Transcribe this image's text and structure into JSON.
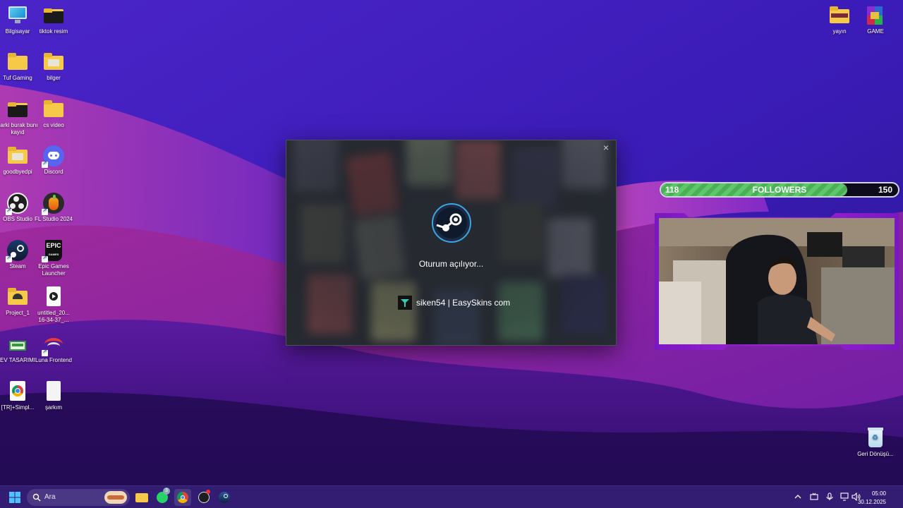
{
  "desktop": {
    "left_icons": [
      {
        "label": "Bilgisayar",
        "icon": "monitor-icon"
      },
      {
        "label": "tiktok resim",
        "icon": "folder-icon"
      },
      {
        "label": "Tuf Gaming",
        "icon": "folder-icon"
      },
      {
        "label": "bilger",
        "icon": "folder-icon"
      },
      {
        "label": "sarki burak bunı kayıd",
        "icon": "folder-icon"
      },
      {
        "label": "cs video",
        "icon": "folder-icon"
      },
      {
        "label": "goodbyedpi",
        "icon": "folder-icon"
      },
      {
        "label": "Discord",
        "icon": "discord-icon"
      },
      {
        "label": "OBS Studio",
        "icon": "obs-icon"
      },
      {
        "label": "FL Studio 2024",
        "icon": "fl-studio-icon"
      },
      {
        "label": "Steam",
        "icon": "steam-icon"
      },
      {
        "label": "Epic Games Launcher",
        "icon": "epic-games-icon"
      },
      {
        "label": "Project_1",
        "icon": "folder-icon"
      },
      {
        "label": "untitled_20... 16-34-37_...",
        "icon": "video-file-icon"
      },
      {
        "label": "EV TASARIMI",
        "icon": "app-icon"
      },
      {
        "label": "Luna Frontend",
        "icon": "luna-icon"
      },
      {
        "label": "[TR]+Simpl...",
        "icon": "chrome-icon"
      },
      {
        "label": "şarkım",
        "icon": "text-file-icon"
      }
    ],
    "right_icons": [
      {
        "label": "yayın",
        "icon": "folder-icon"
      },
      {
        "label": "GAME",
        "icon": "winrar-icon"
      },
      {
        "label": "Geri Dönüşü...",
        "icon": "recycle-bin-icon"
      }
    ]
  },
  "steam_dialog": {
    "status": "Oturum açılıyor...",
    "account": "siken54 | EasySkins com",
    "close_glyph": "×"
  },
  "followers_widget": {
    "current": "118",
    "label": "FOLLOWERS",
    "goal": "150",
    "progress_percent": 78.7
  },
  "taskbar": {
    "search_placeholder": "Ara",
    "whatsapp_badge": "3",
    "time": "05:00",
    "date": "30.12.2025"
  },
  "colors": {
    "taskbar": "#34207a",
    "followers_fill": "#5cc86a",
    "cam_frame": "#a022d8"
  }
}
